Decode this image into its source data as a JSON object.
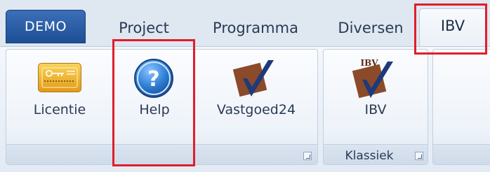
{
  "tabs": {
    "demo": "DEMO",
    "project": "Project",
    "programma": "Programma",
    "diversen": "Diversen",
    "ibv": "IBV"
  },
  "ribbon": {
    "buttons": {
      "licentie": {
        "label": "Licentie",
        "icon": "key-icon"
      },
      "help": {
        "label": "Help",
        "icon": "help-icon"
      },
      "vastgoed24": {
        "label": "Vastgoed24",
        "icon": "checkmark-logo-icon"
      },
      "ibv": {
        "label": "IBV",
        "icon": "ibv-logo-icon"
      }
    },
    "groups": {
      "klassiek": "Klassiek"
    },
    "ibv_logo_text": "IBV"
  },
  "colors": {
    "demo_tab": "#2a5ea8",
    "highlight": "#e01e2b",
    "help_icon": "#2f7fd6",
    "key_icon": "#f0b22e",
    "logo_square": "#8b4a2a",
    "logo_check": "#1f3a7a"
  }
}
